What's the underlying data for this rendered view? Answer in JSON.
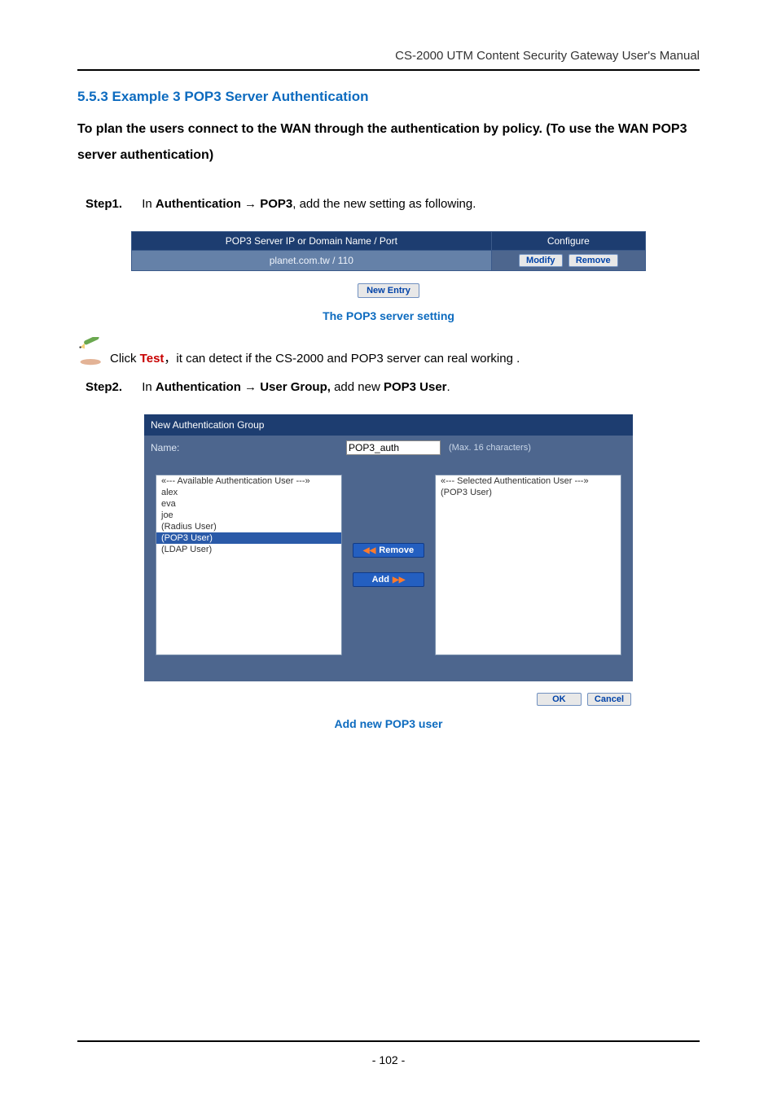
{
  "header": {
    "doc_title": "CS-2000 UTM Content Security Gateway User's Manual"
  },
  "section": {
    "heading": "5.5.3 Example 3 POP3 Server Authentication",
    "intro": "To plan the users connect to the WAN through the authentication by policy. (To use the WAN POP3 server authentication)"
  },
  "step1": {
    "label": "Step1.",
    "prefix": "In ",
    "path_a": "Authentication",
    "arrow": " → ",
    "path_b": "POP3",
    "suffix": ", add the new setting as following."
  },
  "pop3_table": {
    "col1": "POP3 Server IP or Domain Name / Port",
    "col2": "Configure",
    "row_value": "planet.com.tw / 110",
    "modify_btn": "Modify",
    "remove_btn": "Remove",
    "new_entry_btn": "New Entry",
    "caption": "The POP3 server setting"
  },
  "note": {
    "pre": "Click ",
    "test": "Test",
    "post": "，it can detect if the CS-2000 and POP3 server can real working ."
  },
  "step2": {
    "label": "Step2.",
    "prefix": "In ",
    "path_a": "Authentication",
    "arrow": " → ",
    "path_b": "User Group,",
    "mid": " add new ",
    "path_c": "POP3 User",
    "suffix": "."
  },
  "auth_group": {
    "panel_title": "New Authentication Group",
    "name_label": "Name:",
    "name_value": "POP3_auth",
    "name_hint": "(Max. 16 characters)",
    "available_header": "«--- Available Authentication User ---»",
    "available": [
      "alex",
      "eva",
      "joe",
      "(Radius User)",
      "(POP3 User)",
      "(LDAP User)"
    ],
    "selected_header": "«--- Selected Authentication User ---»",
    "selected": [
      "(POP3 User)"
    ],
    "available_selected_index": 4,
    "remove_btn": "Remove",
    "add_btn": "Add",
    "ok_btn": "OK",
    "cancel_btn": "Cancel",
    "caption": "Add new POP3 user"
  },
  "page_number": "- 102 -"
}
